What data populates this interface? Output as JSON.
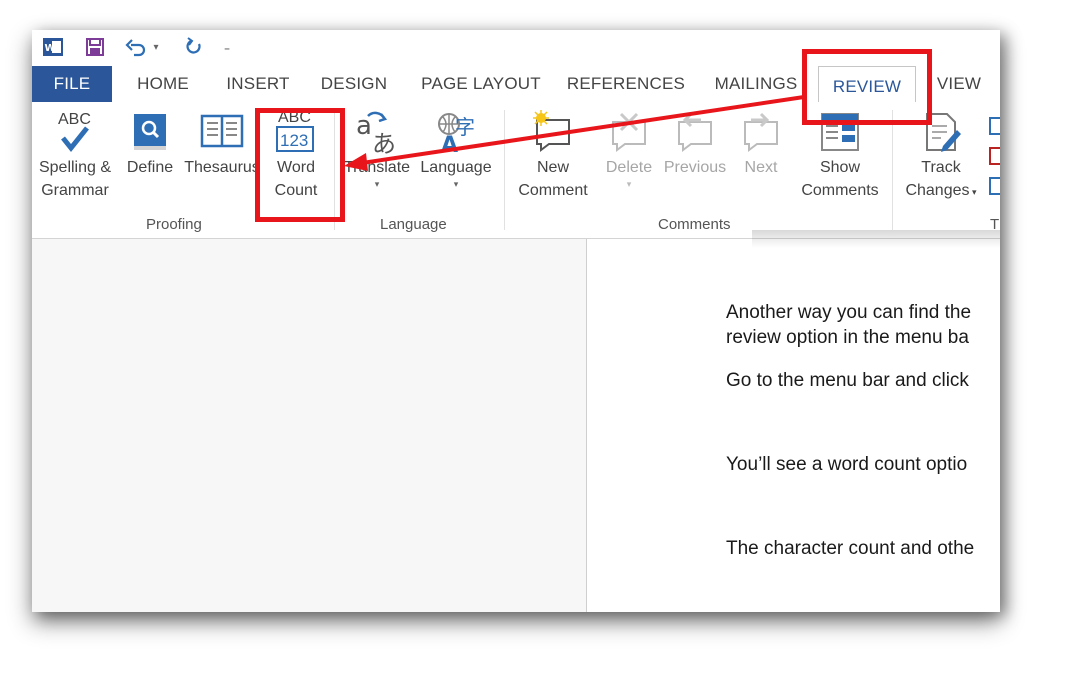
{
  "quick_access": {
    "icons": [
      "word-app-icon",
      "save-icon",
      "undo-icon",
      "undo-dropdown-icon",
      "redo-icon",
      "customize-toolbar-icon"
    ]
  },
  "tabs": [
    {
      "label": "FILE"
    },
    {
      "label": "HOME"
    },
    {
      "label": "INSERT"
    },
    {
      "label": "DESIGN"
    },
    {
      "label": "PAGE LAYOUT"
    },
    {
      "label": "REFERENCES"
    },
    {
      "label": "MAILINGS"
    },
    {
      "label": "REVIEW",
      "active": true
    },
    {
      "label": "VIEW"
    }
  ],
  "ribbon": {
    "proofing": {
      "label": "Proofing",
      "spelling": {
        "line1": "Spelling &",
        "line2": "Grammar",
        "icon_text": "ABC"
      },
      "define": {
        "label": "Define"
      },
      "thesaurus": {
        "label": "Thesaurus"
      },
      "word_count": {
        "line1": "Word",
        "line2": "Count",
        "icon_top": "ABC",
        "icon_bottom": "123"
      }
    },
    "language": {
      "label": "Language",
      "translate": {
        "label": "Translate"
      },
      "language_btn": {
        "label": "Language"
      }
    },
    "comments": {
      "label": "Comments",
      "new_comment": {
        "line1": "New",
        "line2": "Comment"
      },
      "delete": {
        "label": "Delete"
      },
      "previous": {
        "label": "Previous"
      },
      "next": {
        "label": "Next"
      },
      "show_comments": {
        "line1": "Show",
        "line2": "Comments"
      }
    },
    "tracking": {
      "label": "T",
      "track_changes": {
        "line1": "Track",
        "line2": "Changes"
      }
    }
  },
  "document": {
    "lines": [
      "Another way you can find the",
      "review option in the menu ba",
      "Go to the menu bar and click",
      "You’ll see a word count optio",
      "The character count and othe"
    ]
  },
  "colors": {
    "file_tab": "#2b579a",
    "active_tab_text": "#2b579a",
    "highlight": "#e8161b",
    "icon_blue": "#2e6eb5"
  }
}
